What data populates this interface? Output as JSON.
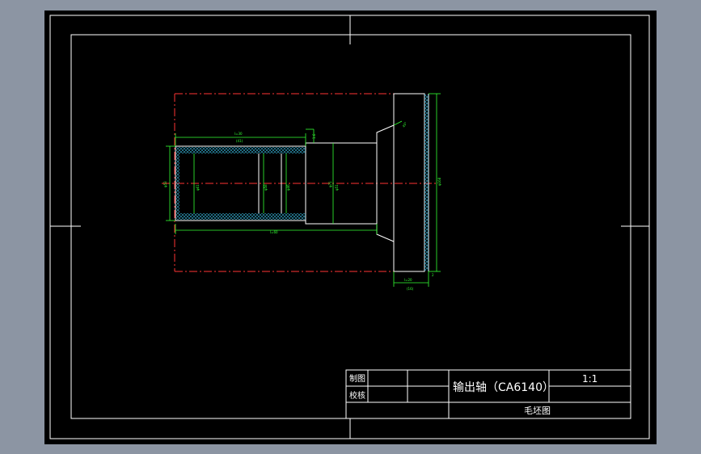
{
  "colors": {
    "window_bg": "#8c95a3",
    "canvas_bg": "#000000",
    "frame": "#ffffff",
    "outline": "#ffffff",
    "dimension": "#33ff33",
    "centerline": "#ff3333",
    "hatch": "#33aacc"
  },
  "title_block": {
    "drawn_label": "制图",
    "checked_label": "校核",
    "part_name": "输出轴（CA6140）",
    "scale": "1:1",
    "drawing_title": "毛坯图"
  },
  "dimensions": {
    "d1": "φ53",
    "d2": "φ61",
    "d3": "φ58",
    "d4": "φ46",
    "d5": "φ51",
    "d6": "φ168",
    "d7": "φ71",
    "l_top": "l=30",
    "l_top_sub": "(41)",
    "l_bottom": "l=60",
    "l_flange": "l=20",
    "l_flange_sub": "(16)",
    "small_step": "1.6",
    "chamfer": "45°",
    "flange_offset": "2"
  }
}
